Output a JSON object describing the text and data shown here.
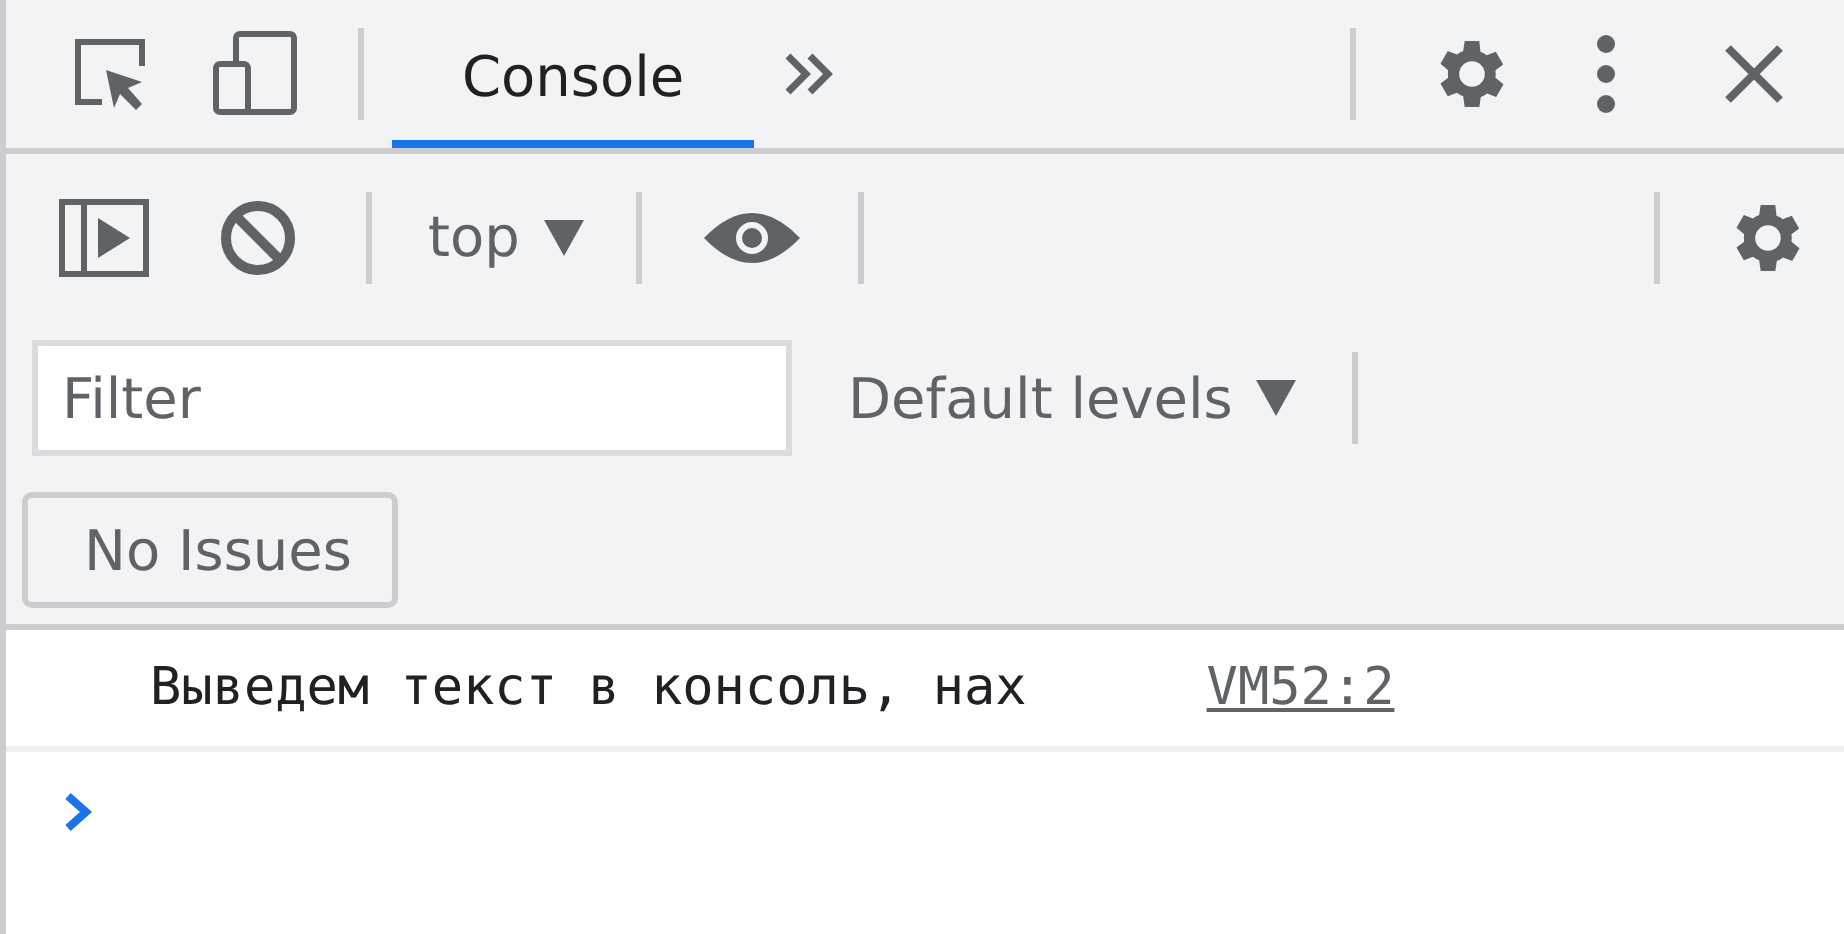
{
  "tabs": [
    {
      "label": "Console",
      "selected": true
    }
  ],
  "toolbar": {
    "context": "top"
  },
  "filter": {
    "placeholder": "Filter",
    "levels": "Default levels"
  },
  "issues_button": "No Issues",
  "messages": [
    {
      "text": "Выведем текст в консоль, нах",
      "source": "VM52:2"
    }
  ]
}
